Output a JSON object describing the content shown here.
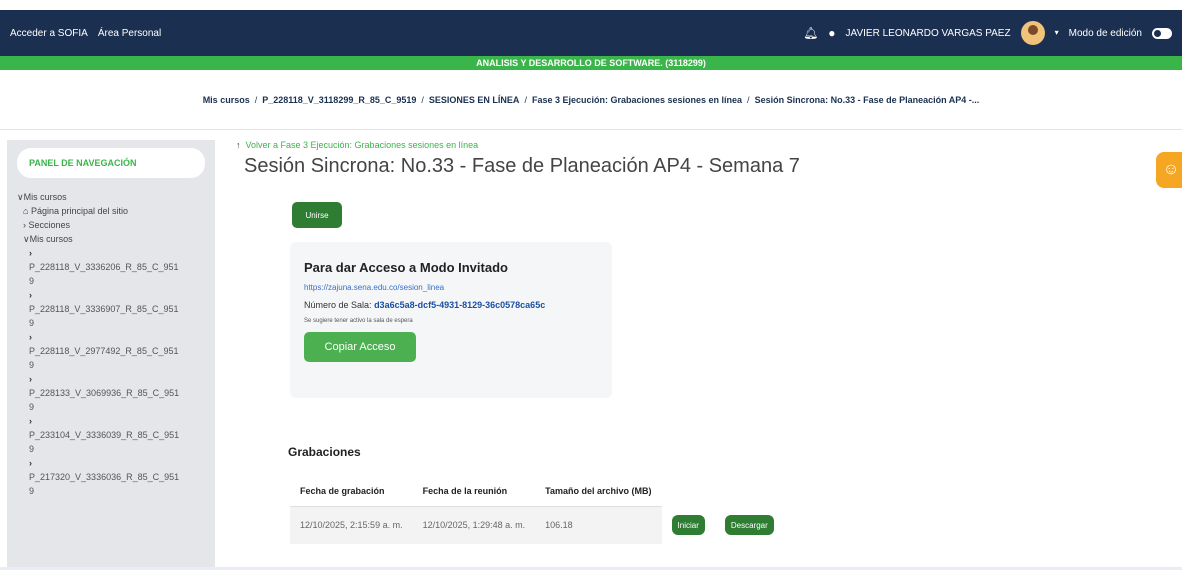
{
  "topbar": {
    "link_sofia": "Acceder a SOFIA",
    "link_personal": "Área Personal",
    "user_name": "JAVIER LEONARDO VARGAS PAEZ",
    "edit_mode_label": "Modo de edición",
    "bell_icon": "bell-icon",
    "chat_icon": "chat-icon"
  },
  "course": {
    "name": "ANALISIS Y DESARROLLO DE SOFTWARE. (3118299)"
  },
  "breadcrumb": [
    "Mis cursos",
    "P_228118_V_3118299_R_85_C_9519",
    "SESIONES EN LÍNEA",
    "Fase 3 Ejecución: Grabaciones sesiones en línea",
    "Sesión Sincrona: No.33 - Fase de Planeación AP4 -..."
  ],
  "sidebar": {
    "title": "PANEL DE NAVEGACIÓN",
    "root": "Mis cursos",
    "home": "Página principal del sitio",
    "sections": "Secciones",
    "my_courses": "Mis cursos",
    "courses": [
      {
        "line1": "P_228118_V_3336206_R_85_C_951",
        "line2": "9"
      },
      {
        "line1": "P_228118_V_3336907_R_85_C_951",
        "line2": "9"
      },
      {
        "line1": "P_228118_V_2977492_R_85_C_951",
        "line2": "9"
      },
      {
        "line1": "P_228133_V_3069936_R_85_C_951",
        "line2": "9"
      },
      {
        "line1": "P_233104_V_3336039_R_85_C_951",
        "line2": "9"
      },
      {
        "line1": "P_217320_V_3336036_R_85_C_951",
        "line2": "9"
      }
    ]
  },
  "main": {
    "back_link": "Volver a Fase 3 Ejecución: Grabaciones sesiones en línea",
    "title": "Sesión Sincrona: No.33 - Fase de Planeación AP4 - Semana 7",
    "join_button": "Unirse",
    "guest_card": {
      "title": "Para dar Acceso a Modo Invitado",
      "url": "https://zajuna.sena.edu.co/sesion_linea",
      "room_label": "Número de Sala:",
      "room_id": "d3a6c5a8-dcf5-4931-8129-36c0578ca65c",
      "note": "Se sugiere tener activo la sala de espera",
      "copy_button": "Copiar Acceso"
    },
    "recordings": {
      "title": "Grabaciones",
      "headers": [
        "Fecha de grabación",
        "Fecha de la reunión",
        "Tamaño del archivo (MB)"
      ],
      "rows": [
        {
          "recorded": "12/10/2025, 2:15:59 a. m.",
          "meeting": "12/10/2025, 1:29:48 a. m.",
          "size": "106.18",
          "play": "Iniciar",
          "download": "Descargar"
        }
      ]
    }
  },
  "colors": {
    "navbar": "#1b3050",
    "brand_green": "#39b54a",
    "button_green": "#2e7d32",
    "help_orange": "#f5a623"
  }
}
